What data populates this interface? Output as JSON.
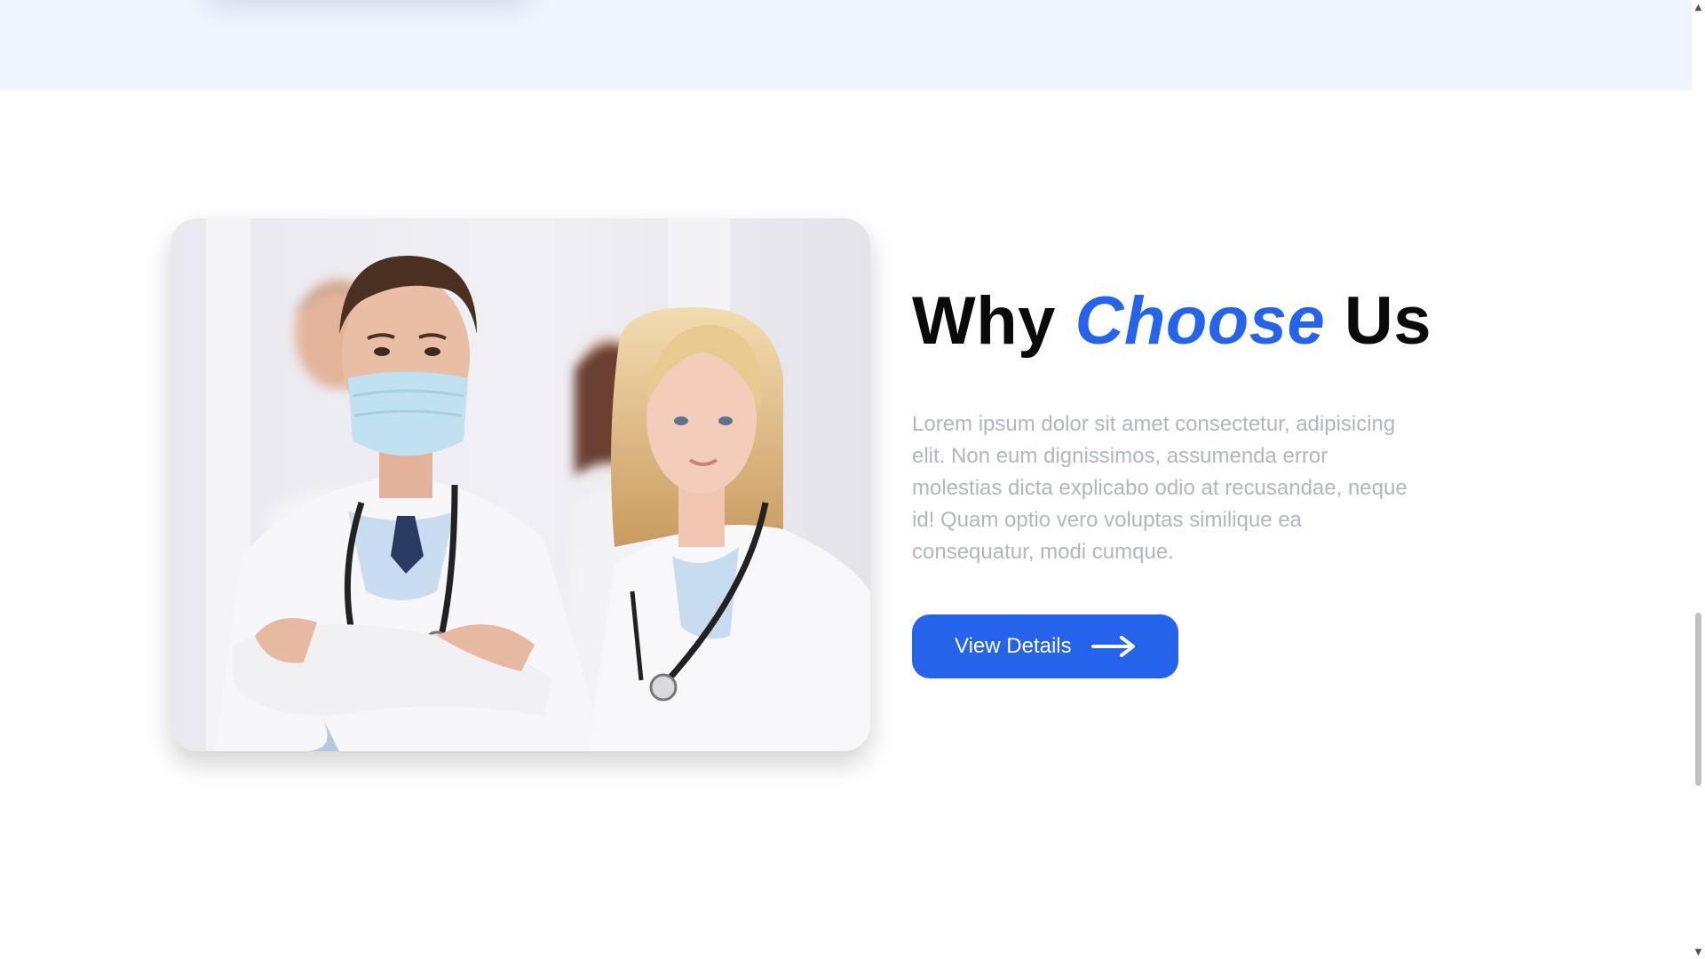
{
  "section": {
    "heading_part1": "Why",
    "heading_accent": "Choose",
    "heading_part2": "Us",
    "body": "Lorem ipsum dolor sit amet consectetur, adipisicing elit. Non eum dignissimos, assumenda error molestias dicta explicabo odio at recusandae, neque id! Quam optio vero voluptas similique ea consequatur, modi cumque.",
    "button_label": "View Details",
    "button_icon": "arrow-right-icon",
    "image_alt": "doctors-team-photo"
  },
  "colors": {
    "accent": "#2563eb",
    "band": "#eef5ff",
    "body_text": "#b0b6c2",
    "heading": "#0a0a0a"
  },
  "scrollbar": {
    "up_icon": "chevron-up-icon",
    "down_icon": "chevron-down-icon"
  }
}
